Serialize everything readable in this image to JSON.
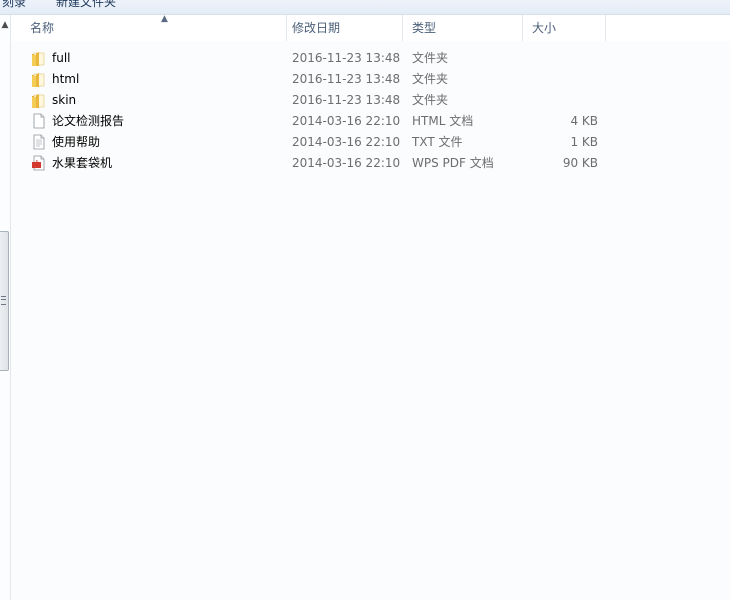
{
  "toolbar": {
    "left_button": "刻录",
    "new_folder_button": "新建文件夹"
  },
  "columns": {
    "name": "名称",
    "date": "修改日期",
    "type": "类型",
    "size": "大小"
  },
  "files": [
    {
      "name": "full",
      "date": "2016-11-23 13:48",
      "type": "文件夹",
      "size": "",
      "icon": "folder-icon"
    },
    {
      "name": "html",
      "date": "2016-11-23 13:48",
      "type": "文件夹",
      "size": "",
      "icon": "folder-icon"
    },
    {
      "name": "skin",
      "date": "2016-11-23 13:48",
      "type": "文件夹",
      "size": "",
      "icon": "folder-icon"
    },
    {
      "name": "论文检测报告",
      "date": "2014-03-16 22:10",
      "type": "HTML 文档",
      "size": "4 KB",
      "icon": "html-file-icon"
    },
    {
      "name": "使用帮助",
      "date": "2014-03-16 22:10",
      "type": "TXT 文件",
      "size": "1 KB",
      "icon": "text-file-icon"
    },
    {
      "name": "水果套袋机",
      "date": "2014-03-16 22:10",
      "type": "WPS PDF 文档",
      "size": "90 KB",
      "icon": "pdf-file-icon"
    }
  ],
  "colors": {
    "folder": "#f2c94c",
    "pdf_red": "#d23a2f",
    "header_text": "#4c607a",
    "meta_text": "#6d6d6d"
  }
}
